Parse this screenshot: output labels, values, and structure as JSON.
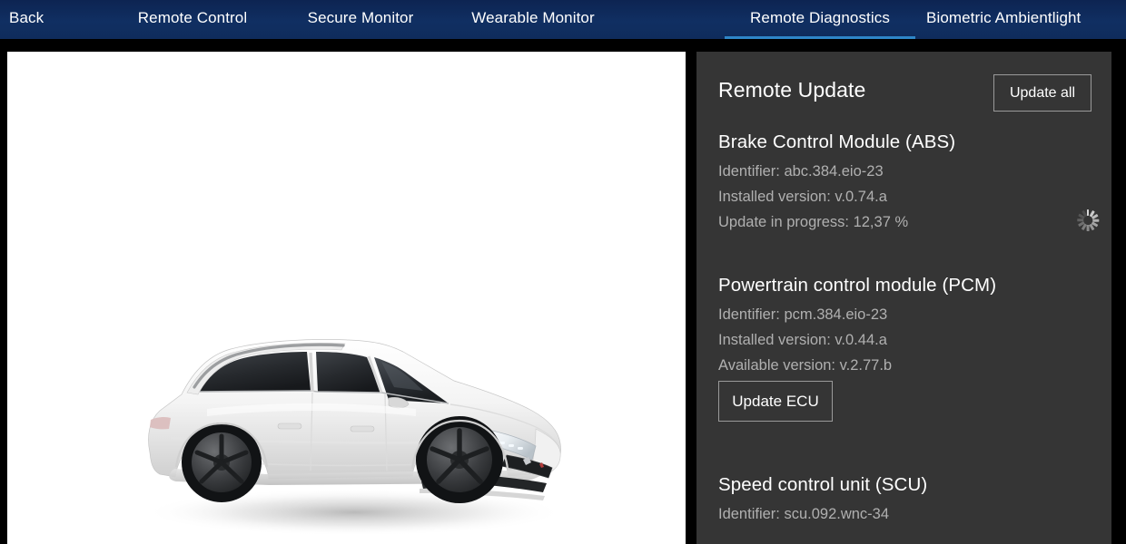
{
  "nav": {
    "tabs": [
      {
        "label": "Back",
        "active": false,
        "name": "tab-back"
      },
      {
        "label": "Remote Control",
        "active": false,
        "name": "tab-remote-control"
      },
      {
        "label": "Secure Monitor",
        "active": false,
        "name": "tab-secure-monitor"
      },
      {
        "label": "Wearable Monitor",
        "active": false,
        "name": "tab-wearable-monitor"
      },
      {
        "label": "Remote Diagnostics",
        "active": true,
        "name": "tab-remote-diagnostics"
      },
      {
        "label": "Biometric Ambientlight",
        "active": false,
        "name": "tab-biometric-ambientlight"
      }
    ],
    "background_color": "#102f62",
    "active_underline_color": "#2e86c8",
    "text_color": "#ffffff"
  },
  "vehicle": {
    "alt": "white estate car, front three-quarter view",
    "body_color": "#ffffff",
    "panel_background": "#ffffff"
  },
  "panel": {
    "title": "Remote Update",
    "background_color": "#353535",
    "update_all_label": "Update all",
    "modules": [
      {
        "title": "Brake Control Module (ABS)",
        "lines": [
          "Identifier: abc.384.eio-23",
          "Installed version: v.0.74.a",
          "Update in progress: 12,37 %"
        ],
        "spinner": true,
        "button": null
      },
      {
        "title": "Powertrain control module (PCM)",
        "lines": [
          "Identifier: pcm.384.eio-23",
          "Installed version: v.0.44.a",
          "Available version: v.2.77.b"
        ],
        "spinner": false,
        "button": "Update ECU"
      },
      {
        "title": "Speed control unit (SCU)",
        "lines": [
          "Identifier: scu.092.wnc-34"
        ],
        "spinner": false,
        "button": null
      }
    ]
  }
}
